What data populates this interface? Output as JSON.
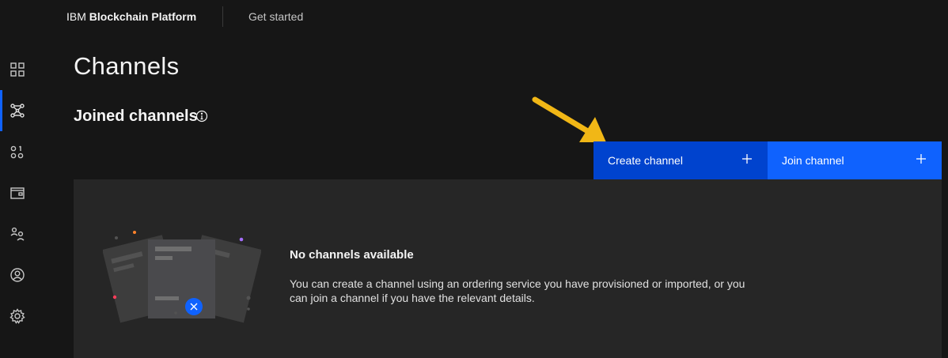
{
  "header": {
    "brand_prefix": "IBM",
    "brand_name": "Blockchain Platform",
    "get_started": "Get started"
  },
  "sidebar": {
    "items": [
      {
        "name": "nodes",
        "icon": "grid-icon"
      },
      {
        "name": "channels",
        "icon": "network-icon",
        "active": true
      },
      {
        "name": "smart-contracts",
        "icon": "contracts-icon"
      },
      {
        "name": "wallet",
        "icon": "wallet-icon"
      },
      {
        "name": "users",
        "icon": "users-icon"
      },
      {
        "name": "organizations",
        "icon": "user-avatar-icon"
      },
      {
        "name": "settings",
        "icon": "gear-icon"
      }
    ]
  },
  "main": {
    "title": "Channels",
    "section_title": "Joined channels",
    "buttons": {
      "create": "Create channel",
      "join": "Join channel"
    },
    "empty_state": {
      "title": "No channels available",
      "description": "You can create a channel using an ordering service you have provisioned or imported, or you can join a channel if you have the relevant details."
    }
  },
  "colors": {
    "background": "#161616",
    "panel": "#262626",
    "primary_button": "#0f62fe",
    "pressed_button": "#0043ce",
    "annotation_arrow": "#f1b716",
    "active_indicator": "#0f62fe"
  }
}
